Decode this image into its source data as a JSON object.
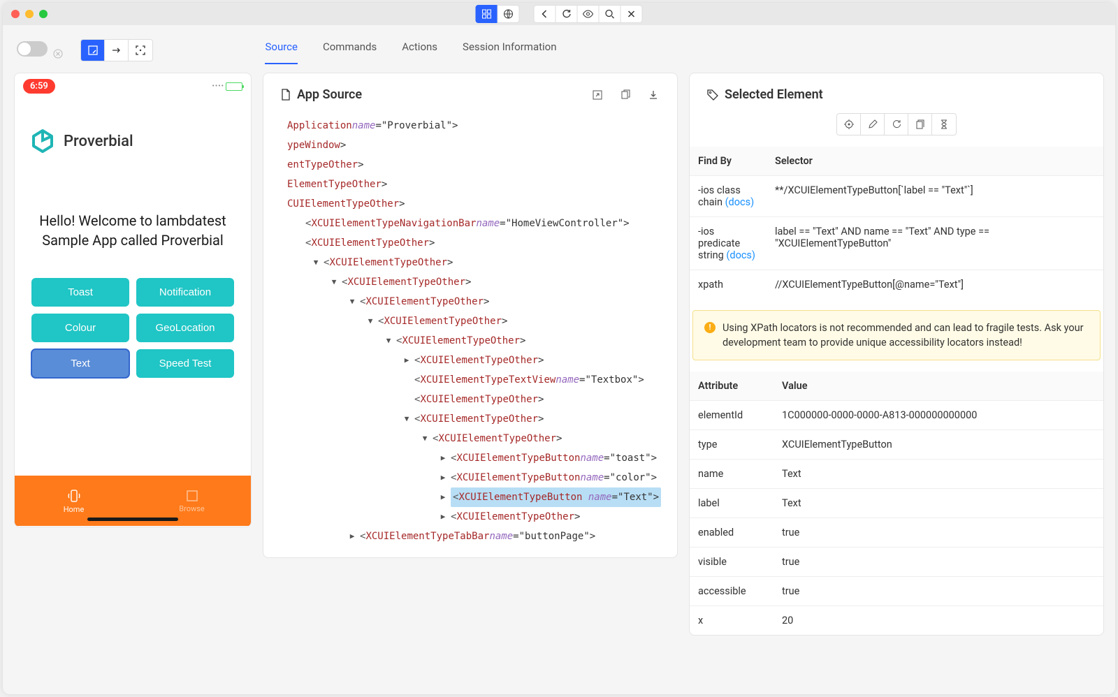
{
  "tabs": {
    "source": "Source",
    "commands": "Commands",
    "actions": "Actions",
    "session": "Session Information"
  },
  "device": {
    "time": "6:59",
    "app_name": "Proverbial",
    "welcome": "Hello! Welcome to lambdatest Sample App called Proverbial",
    "buttons": {
      "toast": "Toast",
      "notification": "Notification",
      "colour": "Colour",
      "geolocation": "GeoLocation",
      "text": "Text",
      "speedtest": "Speed Test"
    },
    "tabbar": {
      "home": "Home",
      "browse": "Browse"
    }
  },
  "source": {
    "title": "App Source",
    "tree": [
      {
        "indent": 0,
        "caret": "",
        "pre": "Application ",
        "attr": "name",
        "val": "=\"Proverbial\">"
      },
      {
        "indent": 0,
        "caret": "",
        "pre": "ypeWindow",
        "attr": "",
        "val": ">"
      },
      {
        "indent": 0,
        "caret": "",
        "pre": "entTypeOther",
        "attr": "",
        "val": ">"
      },
      {
        "indent": 0,
        "caret": "",
        "pre": "ElementTypeOther",
        "attr": "",
        "val": ">"
      },
      {
        "indent": 0,
        "caret": "",
        "pre": "CUIElementTypeOther",
        "attr": "",
        "val": ">"
      },
      {
        "indent": 1,
        "caret": "",
        "pre": "<",
        "tag": "XCUIElementTypeNavigationBar",
        "attr": " name",
        "val": "=\"HomeViewController\">"
      },
      {
        "indent": 1,
        "caret": "",
        "pre": "<",
        "tag": "XCUIElementTypeOther",
        "attr": "",
        "val": ">"
      },
      {
        "indent": 2,
        "caret": "▼",
        "pre": "<",
        "tag": "XCUIElementTypeOther",
        "attr": "",
        "val": ">"
      },
      {
        "indent": 3,
        "caret": "▼",
        "pre": "<",
        "tag": "XCUIElementTypeOther",
        "attr": "",
        "val": ">"
      },
      {
        "indent": 4,
        "caret": "▼",
        "pre": "<",
        "tag": "XCUIElementTypeOther",
        "attr": "",
        "val": ">"
      },
      {
        "indent": 5,
        "caret": "▼",
        "pre": "<",
        "tag": "XCUIElementTypeOther",
        "attr": "",
        "val": ">"
      },
      {
        "indent": 6,
        "caret": "▼",
        "pre": "<",
        "tag": "XCUIElementTypeOther",
        "attr": "",
        "val": ">"
      },
      {
        "indent": 7,
        "caret": "▶",
        "pre": "<",
        "tag": "XCUIElementTypeOther",
        "attr": "",
        "val": ">"
      },
      {
        "indent": 7,
        "caret": "",
        "pre": "<",
        "tag": "XCUIElementTypeTextView",
        "attr": " name",
        "val": "=\"Textbox\">"
      },
      {
        "indent": 7,
        "caret": "",
        "pre": "<",
        "tag": "XCUIElementTypeOther",
        "attr": "",
        "val": ">"
      },
      {
        "indent": 7,
        "caret": "▼",
        "pre": "<",
        "tag": "XCUIElementTypeOther",
        "attr": "",
        "val": ">"
      },
      {
        "indent": 8,
        "caret": "▼",
        "pre": "<",
        "tag": "XCUIElementTypeOther",
        "attr": "",
        "val": ">"
      },
      {
        "indent": 9,
        "caret": "▶",
        "pre": "<",
        "tag": "XCUIElementTypeButton",
        "attr": " name",
        "val": "=\"toast\">"
      },
      {
        "indent": 9,
        "caret": "▶",
        "pre": "<",
        "tag": "XCUIElementTypeButton",
        "attr": " name",
        "val": "=\"color\">"
      },
      {
        "indent": 9,
        "caret": "▶",
        "pre": "<",
        "tag": "XCUIElementTypeButton",
        "attr": " name",
        "val": "=\"Text\">",
        "selected": true
      },
      {
        "indent": 9,
        "caret": "▶",
        "pre": "<",
        "tag": "XCUIElementTypeOther",
        "attr": "",
        "val": ">"
      },
      {
        "indent": 4,
        "caret": "▶",
        "pre": "<",
        "tag": "XCUIElementTypeTabBar",
        "attr": " name",
        "val": "=\"buttonPage\">"
      }
    ]
  },
  "selected": {
    "title": "Selected Element",
    "headers": {
      "findby": "Find By",
      "selector": "Selector",
      "attribute": "Attribute",
      "value": "Value"
    },
    "docs": "(docs)",
    "locators": [
      {
        "key": "-ios class chain",
        "docs": true,
        "val": "**/XCUIElementTypeButton[`label == \"Text\"`]"
      },
      {
        "key": "-ios predicate string",
        "docs": true,
        "val": "label == \"Text\" AND name == \"Text\" AND type == \"XCUIElementTypeButton\""
      },
      {
        "key": "xpath",
        "docs": false,
        "val": "//XCUIElementTypeButton[@name=\"Text\"]"
      }
    ],
    "warning": "Using XPath locators is not recommended and can lead to fragile tests. Ask your development team to provide unique accessibility locators instead!",
    "attrs": [
      {
        "k": "elementId",
        "v": "1C000000-0000-0000-A813-000000000000"
      },
      {
        "k": "type",
        "v": "XCUIElementTypeButton"
      },
      {
        "k": "name",
        "v": "Text"
      },
      {
        "k": "label",
        "v": "Text"
      },
      {
        "k": "enabled",
        "v": "true"
      },
      {
        "k": "visible",
        "v": "true"
      },
      {
        "k": "accessible",
        "v": "true"
      },
      {
        "k": "x",
        "v": "20"
      }
    ]
  }
}
